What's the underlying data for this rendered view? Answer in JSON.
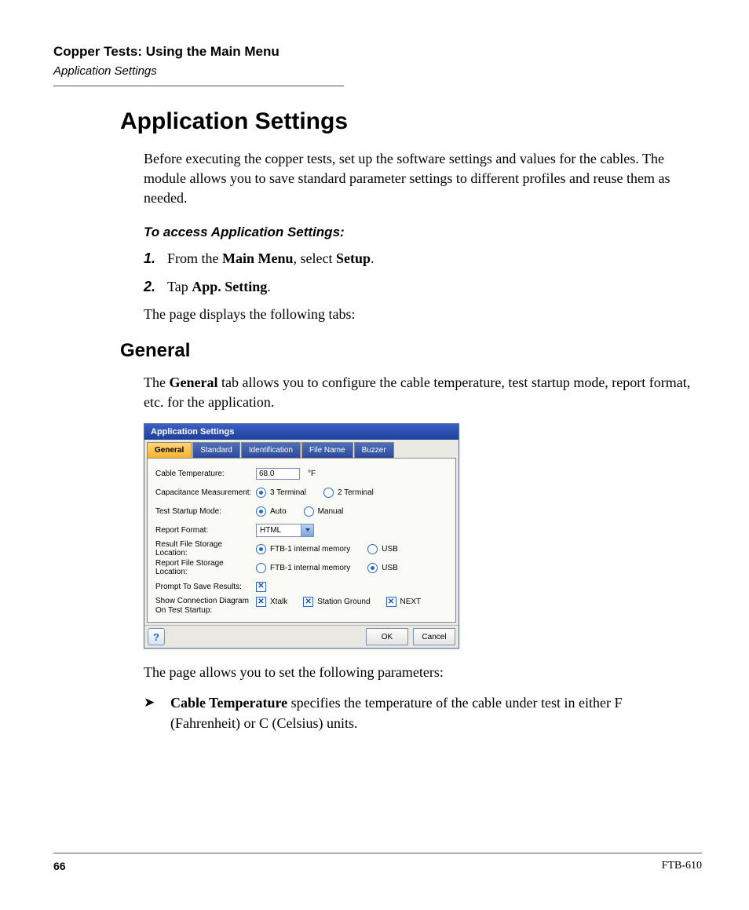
{
  "header": {
    "chapter": "Copper Tests: Using the Main Menu",
    "section": "Application Settings"
  },
  "title": "Application Settings",
  "intro": "Before executing the copper tests, set up the software settings and values for the cables. The module allows you to save standard parameter settings to different profiles and reuse them as needed.",
  "access_heading": "To access Application Settings:",
  "steps": [
    {
      "num": "1.",
      "pre": "From the ",
      "b1": "Main Menu",
      "mid": ", select ",
      "b2": "Setup",
      "post": "."
    },
    {
      "num": "2.",
      "pre": "Tap ",
      "b1": "App. Setting",
      "mid": "",
      "b2": "",
      "post": "."
    }
  ],
  "tabs_intro": "The page displays the following tabs:",
  "general_heading": "General",
  "general_intro_pre": "The ",
  "general_intro_bold": "General",
  "general_intro_post": " tab allows you to configure the cable temperature, test startup mode, report format, etc. for the application.",
  "dialog": {
    "title": "Application Settings",
    "tabs": [
      "General",
      "Standard",
      "Identification",
      "File Name",
      "Buzzer"
    ],
    "rows": {
      "cable_temp": {
        "label": "Cable Temperature:",
        "value": "68.0",
        "unit": "°F"
      },
      "cap_meas": {
        "label": "Capacitance Measurement:",
        "opt1": "3 Terminal",
        "opt2": "2 Terminal"
      },
      "startup": {
        "label": "Test Startup Mode:",
        "opt1": "Auto",
        "opt2": "Manual"
      },
      "report_fmt": {
        "label": "Report Format:",
        "value": "HTML"
      },
      "result_loc": {
        "label": "Result File Storage Location:",
        "opt1": "FTB-1 internal memory",
        "opt2": "USB"
      },
      "report_loc": {
        "label": "Report File Storage Location:",
        "opt1": "FTB-1 internal memory",
        "opt2": "USB"
      },
      "prompt_save": {
        "label": "Prompt To Save Results:"
      },
      "conn_diag": {
        "label1": "Show Connection Diagram",
        "label2": "On Test Startup:",
        "c1": "Xtalk",
        "c2": "Station Ground",
        "c3": "NEXT"
      }
    },
    "buttons": {
      "help": "?",
      "ok": "OK",
      "cancel": "Cancel"
    }
  },
  "params_intro": "The page allows you to set the following parameters:",
  "bullet1_bold": "Cable Temperature",
  "bullet1_rest": " specifies the temperature of the cable under test in either F (Fahrenheit) or C (Celsius) units.",
  "footer": {
    "page": "66",
    "model": "FTB-610"
  }
}
